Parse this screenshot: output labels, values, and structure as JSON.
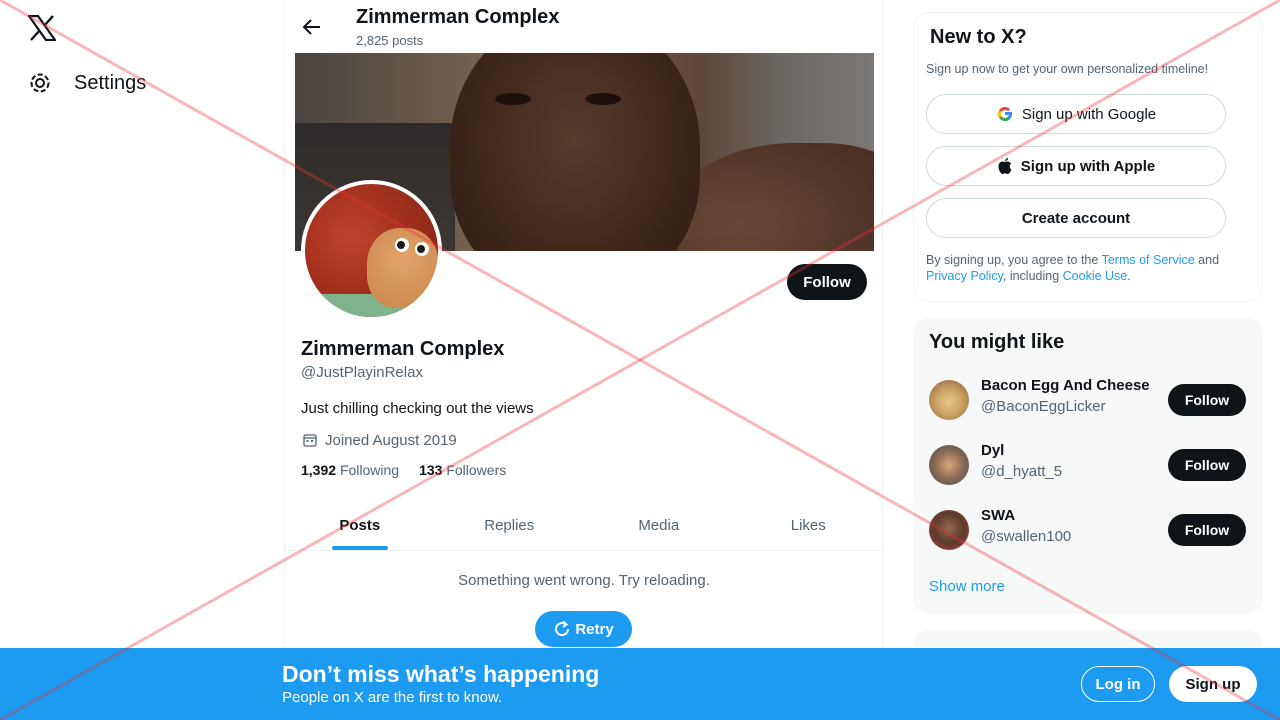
{
  "colors": {
    "accent": "#1d9bf0",
    "text": "#0f1419",
    "muted": "#536471",
    "overlay": "#e8323c"
  },
  "nav": {
    "logo_icon": "x-logo-icon",
    "settings_label": "Settings",
    "settings_icon": "gear-icon"
  },
  "header": {
    "back_icon": "arrow-left-icon",
    "title": "Zimmerman Complex",
    "post_count": "2,825 posts"
  },
  "profile": {
    "follow_label": "Follow",
    "name": "Zimmerman Complex",
    "handle": "@JustPlayinRelax",
    "bio": "Just chilling checking out the views",
    "joined_icon": "calendar-icon",
    "joined": "Joined August 2019",
    "following_count": "1,392",
    "following_label": "Following",
    "followers_count": "133",
    "followers_label": "Followers"
  },
  "tabs": [
    {
      "label": "Posts",
      "active": true
    },
    {
      "label": "Replies",
      "active": false
    },
    {
      "label": "Media",
      "active": false
    },
    {
      "label": "Likes",
      "active": false
    }
  ],
  "feed": {
    "error": "Something went wrong. Try reloading.",
    "retry_label": "Retry",
    "retry_icon": "refresh-icon"
  },
  "new_to_x": {
    "title": "New to X?",
    "subtitle": "Sign up now to get your own personalized timeline!",
    "google_label": "Sign up with Google",
    "google_icon": "google-icon",
    "apple_label": "Sign up with Apple",
    "apple_icon": "apple-icon",
    "create_label": "Create account",
    "legal_prefix": "By signing up, you agree to the ",
    "terms": "Terms of Service",
    "and": " and ",
    "privacy": "Privacy Policy",
    "including": ", including ",
    "cookie": "Cookie Use",
    "period": "."
  },
  "might_like": {
    "title": "You might like",
    "users": [
      {
        "name": "Bacon Egg And Cheese",
        "handle": "@BaconEggLicker",
        "button": "Follow"
      },
      {
        "name": "Dyl",
        "handle": "@d_hyatt_5",
        "button": "Follow"
      },
      {
        "name": "SWA",
        "handle": "@swallen100",
        "button": "Follow"
      }
    ],
    "show_more": "Show more"
  },
  "bottom_bar": {
    "title": "Don’t miss what’s happening",
    "subtitle": "People on X are the first to know.",
    "login_label": "Log in",
    "signup_label": "Sign up"
  }
}
